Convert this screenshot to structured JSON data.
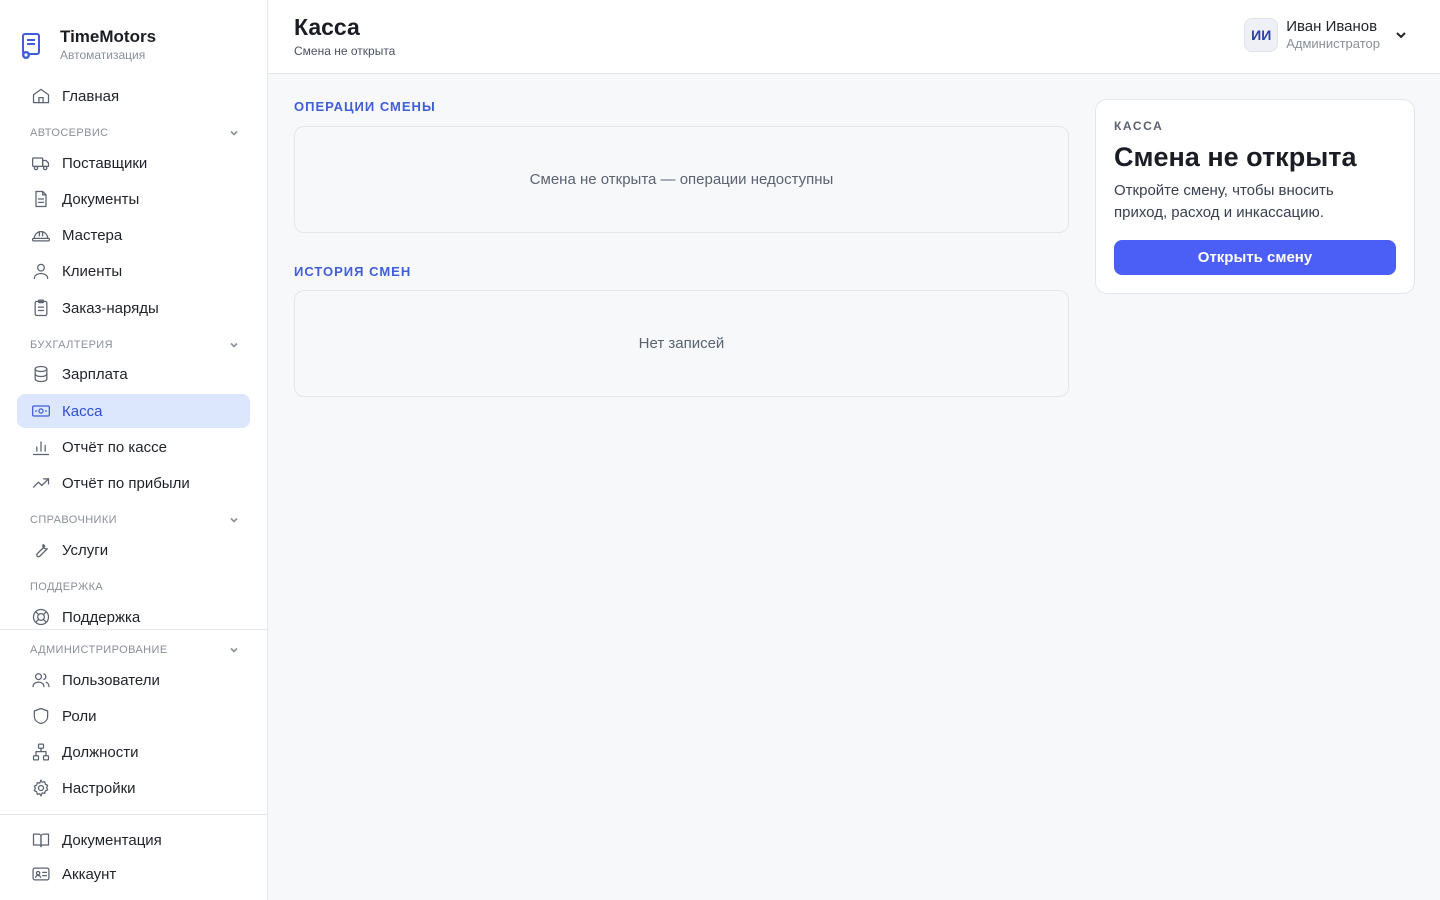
{
  "brand": {
    "name": "TimeMotors",
    "subtitle": "Автоматизация"
  },
  "header": {
    "title": "Касса",
    "subtitle": "Смена не открыта"
  },
  "user": {
    "initials": "ИИ",
    "name": "Иван Иванов",
    "role": "Администратор"
  },
  "sidebar": {
    "home": {
      "label": "Главная",
      "icon": "home-icon"
    },
    "sections": {
      "autoservice": "АВТОСЕРВИС",
      "accounting": "БУХГАЛТЕРИЯ",
      "references": "СПРАВОЧНИКИ",
      "support": "ПОДДЕРЖКА",
      "admin": "АДМИНИСТРИРОВАНИЕ"
    },
    "items": {
      "suppliers": "Поставщики",
      "documents": "Документы",
      "masters": "Мастера",
      "clients": "Клиенты",
      "orders": "Заказ-наряды",
      "salary": "Зарплата",
      "cash": "Касса",
      "cash_report": "Отчёт по кассе",
      "profit_report": "Отчёт по прибыли",
      "services": "Услуги",
      "support": "Поддержка",
      "users": "Пользователи",
      "roles": "Роли",
      "positions": "Должности",
      "settings": "Настройки",
      "docs": "Документация",
      "account": "Аккаунт"
    },
    "active": "cash"
  },
  "main": {
    "operations": {
      "title": "ОПЕРАЦИИ СМЕНЫ",
      "empty": "Смена не открыта — операции недоступны"
    },
    "history": {
      "title": "ИСТОРИЯ СМЕН",
      "empty": "Нет записей"
    }
  },
  "card": {
    "label": "КАССА",
    "title": "Смена не открыта",
    "description": "Откройте смену, чтобы вносить приход, расход и инкассацию.",
    "button": "Открыть смену"
  },
  "colors": {
    "accent": "#4b5ef5",
    "active_bg": "#dce6fd",
    "section_title": "#3f5ed8"
  }
}
